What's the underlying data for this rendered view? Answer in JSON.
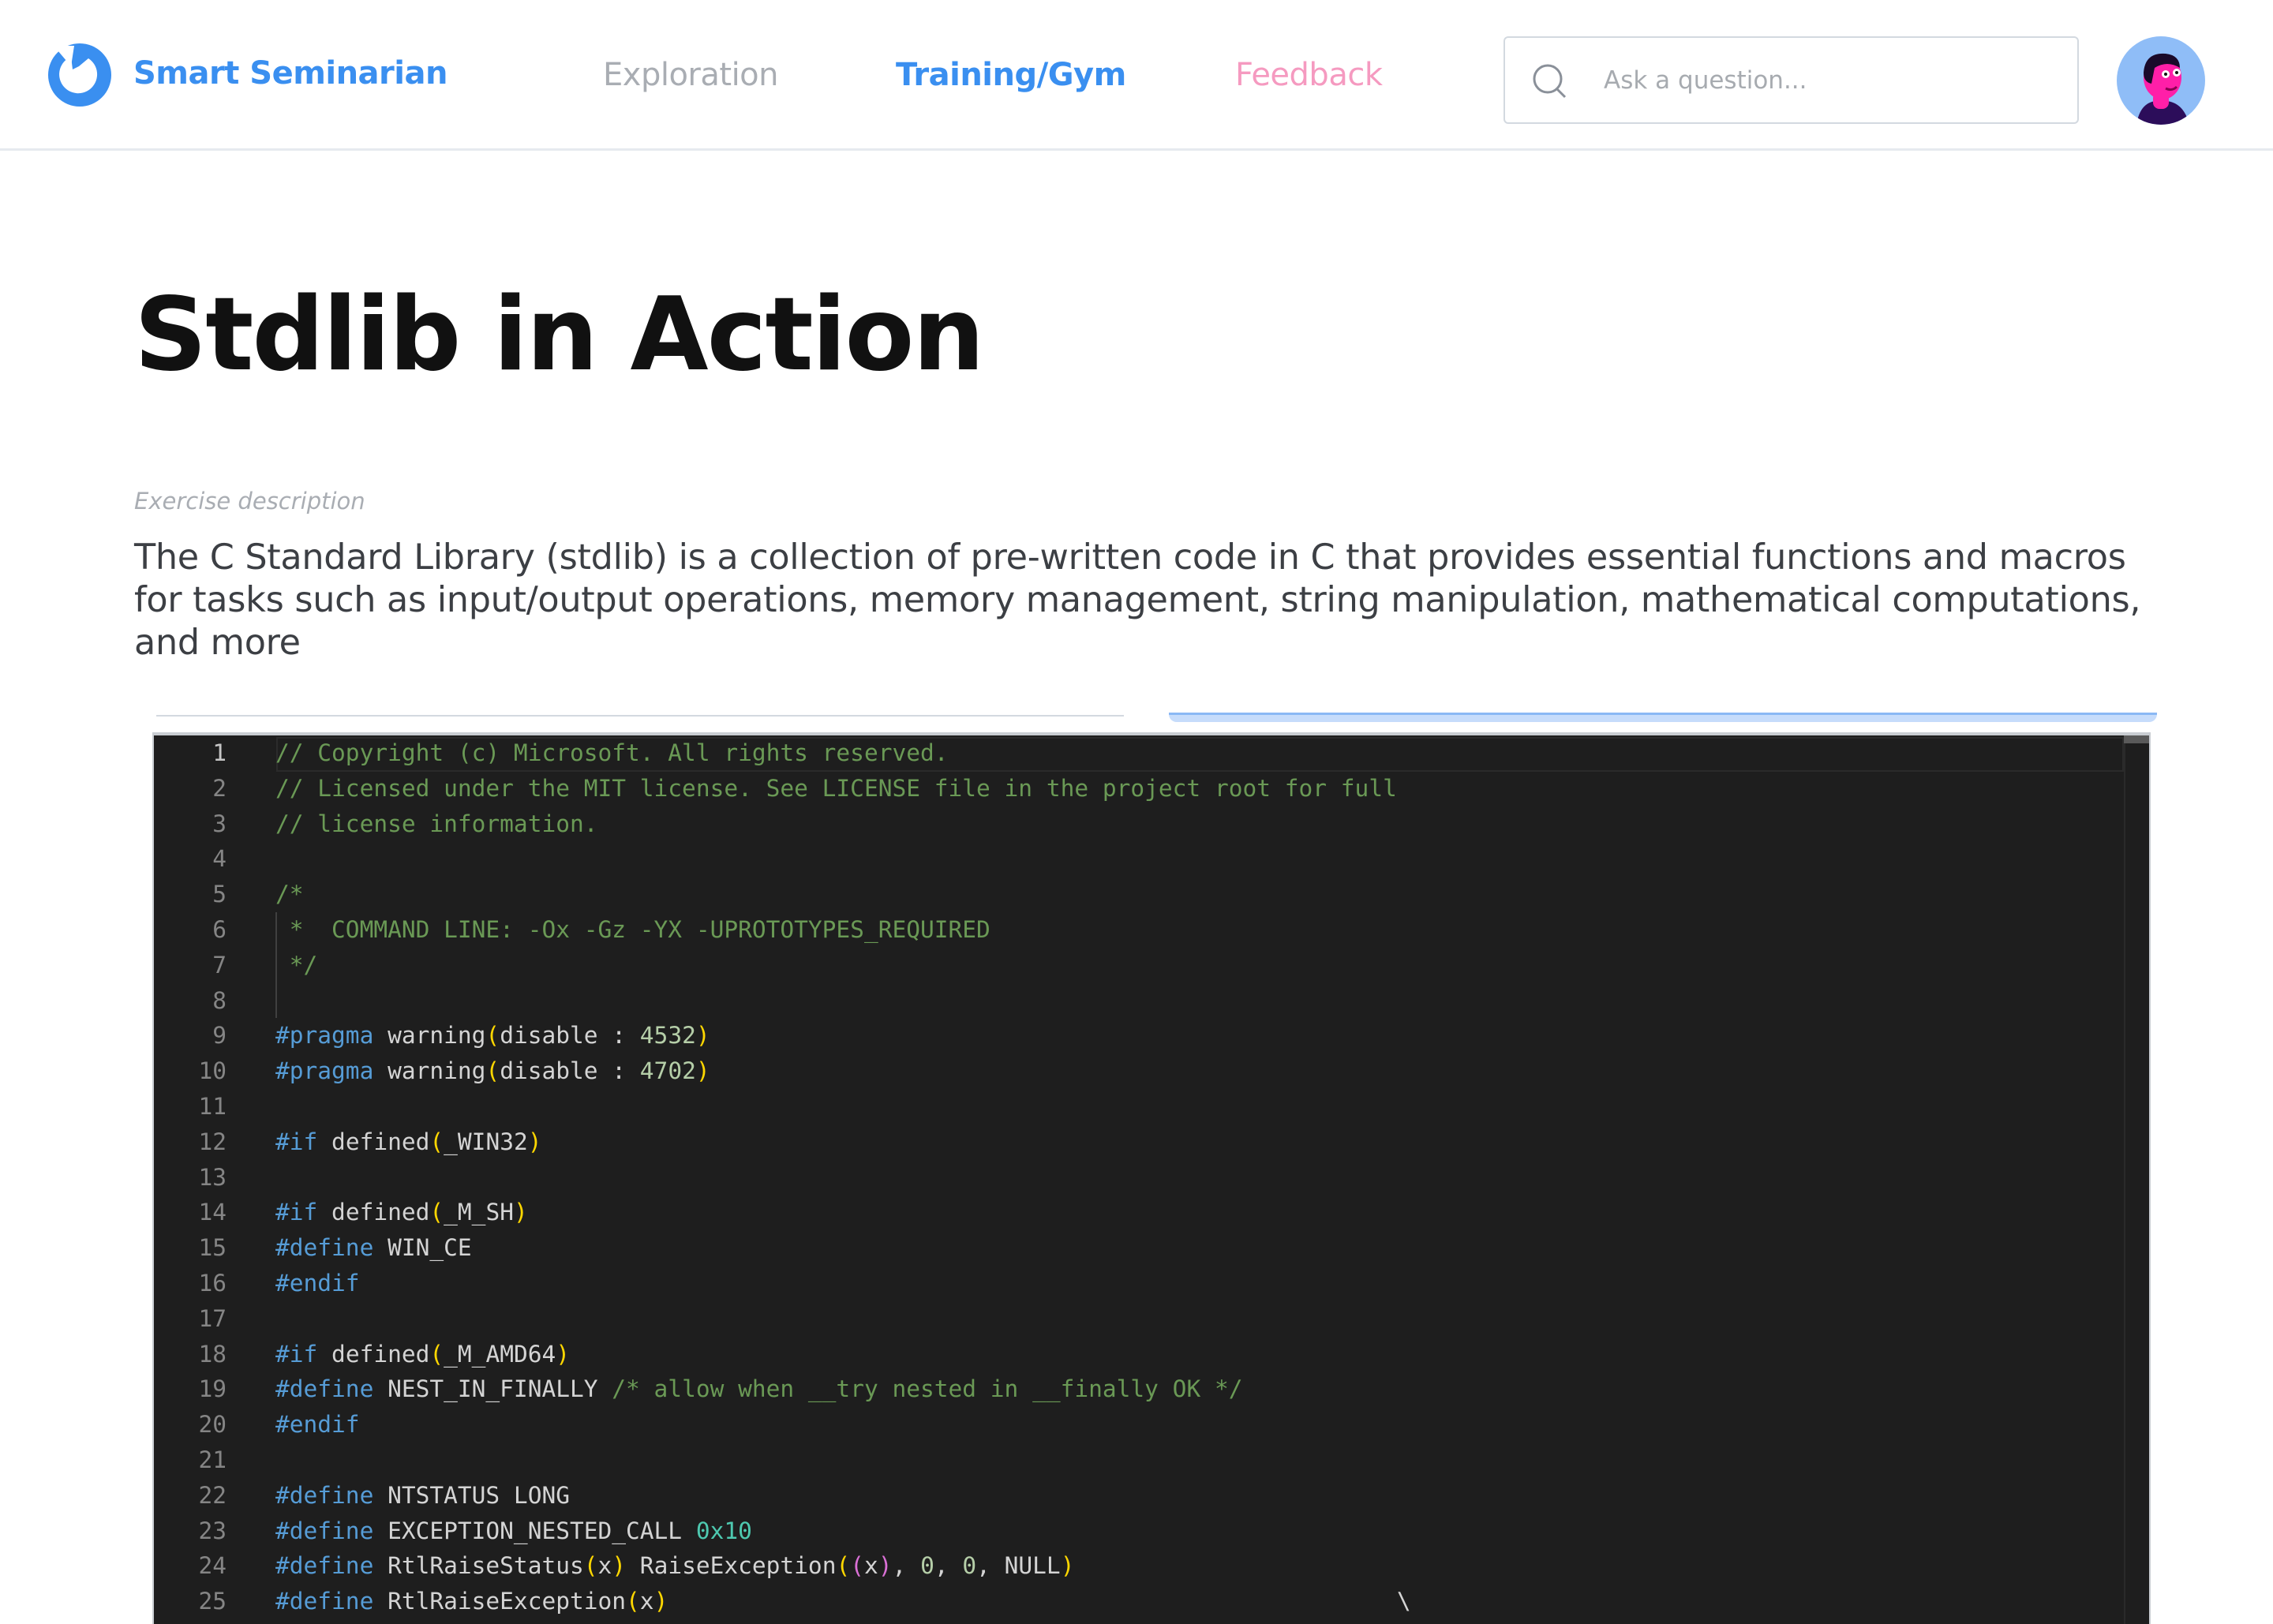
{
  "header": {
    "brand": "Smart Seminarian",
    "nav": [
      {
        "label": "Exploration"
      },
      {
        "label": "Training/Gym",
        "active": true
      },
      {
        "label": "Feedback"
      }
    ],
    "search": {
      "placeholder": "Ask a question...",
      "value": ""
    },
    "colors": {
      "brand": "#3a8ff0",
      "feedback": "#f59ac0",
      "muted": "#a9adb3"
    }
  },
  "main": {
    "title": "Stdlib in Action",
    "description_label": "Exercise description",
    "description": "The C Standard Library (stdlib) is a collection of pre-written code in C that provides essential functions and macros for tasks such as input/output operations, memory management, string manipulation, mathematical computations, and more"
  },
  "editor": {
    "active_line": 1,
    "lines": [
      [
        [
          "comment",
          "// Copyright (c) Microsoft. All rights reserved."
        ]
      ],
      [
        [
          "comment",
          "// Licensed under the MIT license. See LICENSE file in the project root for full"
        ]
      ],
      [
        [
          "comment",
          "// license information."
        ]
      ],
      [],
      [
        [
          "comment",
          "/*"
        ]
      ],
      [
        [
          "comment",
          " *  COMMAND LINE: -Ox -Gz -YX -UPROTOTYPES_REQUIRED"
        ]
      ],
      [
        [
          "comment",
          " */"
        ]
      ],
      [],
      [
        [
          "kw",
          "#pragma"
        ],
        [
          "text",
          " warning"
        ],
        [
          "b1",
          "("
        ],
        [
          "text",
          "disable : "
        ],
        [
          "num",
          "4532"
        ],
        [
          "b1",
          ")"
        ]
      ],
      [
        [
          "kw",
          "#pragma"
        ],
        [
          "text",
          " warning"
        ],
        [
          "b1",
          "("
        ],
        [
          "text",
          "disable : "
        ],
        [
          "num",
          "4702"
        ],
        [
          "b1",
          ")"
        ]
      ],
      [],
      [
        [
          "kw",
          "#if"
        ],
        [
          "text",
          " defined"
        ],
        [
          "b1",
          "("
        ],
        [
          "text",
          "_WIN32"
        ],
        [
          "b1",
          ")"
        ]
      ],
      [],
      [
        [
          "kw",
          "#if"
        ],
        [
          "text",
          " defined"
        ],
        [
          "b1",
          "("
        ],
        [
          "text",
          "_M_SH"
        ],
        [
          "b1",
          ")"
        ]
      ],
      [
        [
          "kw",
          "#define"
        ],
        [
          "text",
          " WIN_CE"
        ]
      ],
      [
        [
          "kw",
          "#endif"
        ]
      ],
      [],
      [
        [
          "kw",
          "#if"
        ],
        [
          "text",
          " defined"
        ],
        [
          "b1",
          "("
        ],
        [
          "text",
          "_M_AMD64"
        ],
        [
          "b1",
          ")"
        ]
      ],
      [
        [
          "kw",
          "#define"
        ],
        [
          "text",
          " NEST_IN_FINALLY "
        ],
        [
          "comment",
          "/* allow when __try nested in __finally OK */"
        ]
      ],
      [
        [
          "kw",
          "#endif"
        ]
      ],
      [],
      [
        [
          "kw",
          "#define"
        ],
        [
          "text",
          " NTSTATUS LONG"
        ]
      ],
      [
        [
          "kw",
          "#define"
        ],
        [
          "text",
          " EXCEPTION_NESTED_CALL "
        ],
        [
          "hex",
          "0x10"
        ]
      ],
      [
        [
          "kw",
          "#define"
        ],
        [
          "text",
          " RtlRaiseStatus"
        ],
        [
          "b1",
          "("
        ],
        [
          "text",
          "x"
        ],
        [
          "b1",
          ")"
        ],
        [
          "text",
          " RaiseException"
        ],
        [
          "b1",
          "("
        ],
        [
          "b2",
          "("
        ],
        [
          "text",
          "x"
        ],
        [
          "b2",
          ")"
        ],
        [
          "text",
          ", "
        ],
        [
          "num",
          "0"
        ],
        [
          "text",
          ", "
        ],
        [
          "num",
          "0"
        ],
        [
          "text",
          ", NULL"
        ],
        [
          "b1",
          ")"
        ]
      ],
      [
        [
          "kw",
          "#define"
        ],
        [
          "text",
          " RtlRaiseException"
        ],
        [
          "b1",
          "("
        ],
        [
          "text",
          "x"
        ],
        [
          "b1",
          ")"
        ],
        [
          "text",
          "                                                    \\"
        ]
      ]
    ],
    "colors": {
      "background": "#1e1e1e",
      "comment": "#6a9955",
      "keyword": "#569cd6",
      "number": "#b5cea8",
      "hex": "#4ec9b0",
      "bracket": "#ffd700",
      "bracket_nested": "#da70d6",
      "text": "#d4d4d4"
    }
  }
}
